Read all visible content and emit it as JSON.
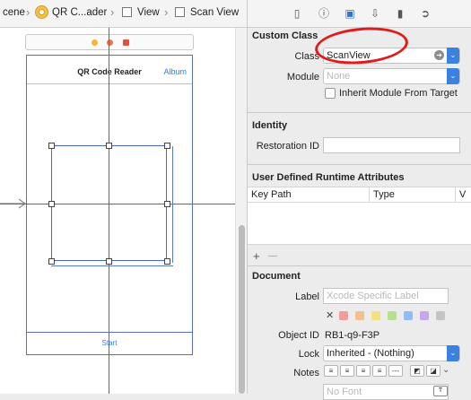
{
  "jumpbar": {
    "crumbs": [
      "cene",
      "QR C...ader",
      "View",
      "Scan View"
    ]
  },
  "canvas": {
    "nav_title": "QR Code Reader",
    "nav_button": "Album",
    "toolbar_button": "Start"
  },
  "inspector": {
    "tabs": [
      "file-icon",
      "help-icon",
      "identity-icon",
      "attributes-icon",
      "size-icon",
      "connections-icon"
    ],
    "custom_class": {
      "heading": "Custom Class",
      "class_label": "Class",
      "class_value": "ScanView",
      "module_label": "Module",
      "module_placeholder": "None",
      "inherit_label": "Inherit Module From Target"
    },
    "identity": {
      "heading": "Identity",
      "restoration_label": "Restoration ID",
      "restoration_value": ""
    },
    "runtime_attrs": {
      "heading": "User Defined Runtime Attributes",
      "columns": [
        "Key Path",
        "Type",
        "V"
      ],
      "add_label": "+",
      "remove_label": "—"
    },
    "document": {
      "heading": "Document",
      "label_label": "Label",
      "label_placeholder": "Xcode Specific Label",
      "clear_label": "✕",
      "swatches": [
        "#f29b9b",
        "#f6c08c",
        "#f3e07f",
        "#b6e28d",
        "#8fbdf1",
        "#c7a7ec",
        "#c4c4c4"
      ],
      "objectid_label": "Object ID",
      "objectid_value": "RB1-q9-F3P",
      "lock_label": "Lock",
      "lock_value": "Inherited - (Nothing)",
      "notes_label": "Notes",
      "font_placeholder": "No Font"
    }
  },
  "colors": {
    "accent": "#3b82e0",
    "annotation": "#e01b1b",
    "guide": "#4568c8"
  }
}
